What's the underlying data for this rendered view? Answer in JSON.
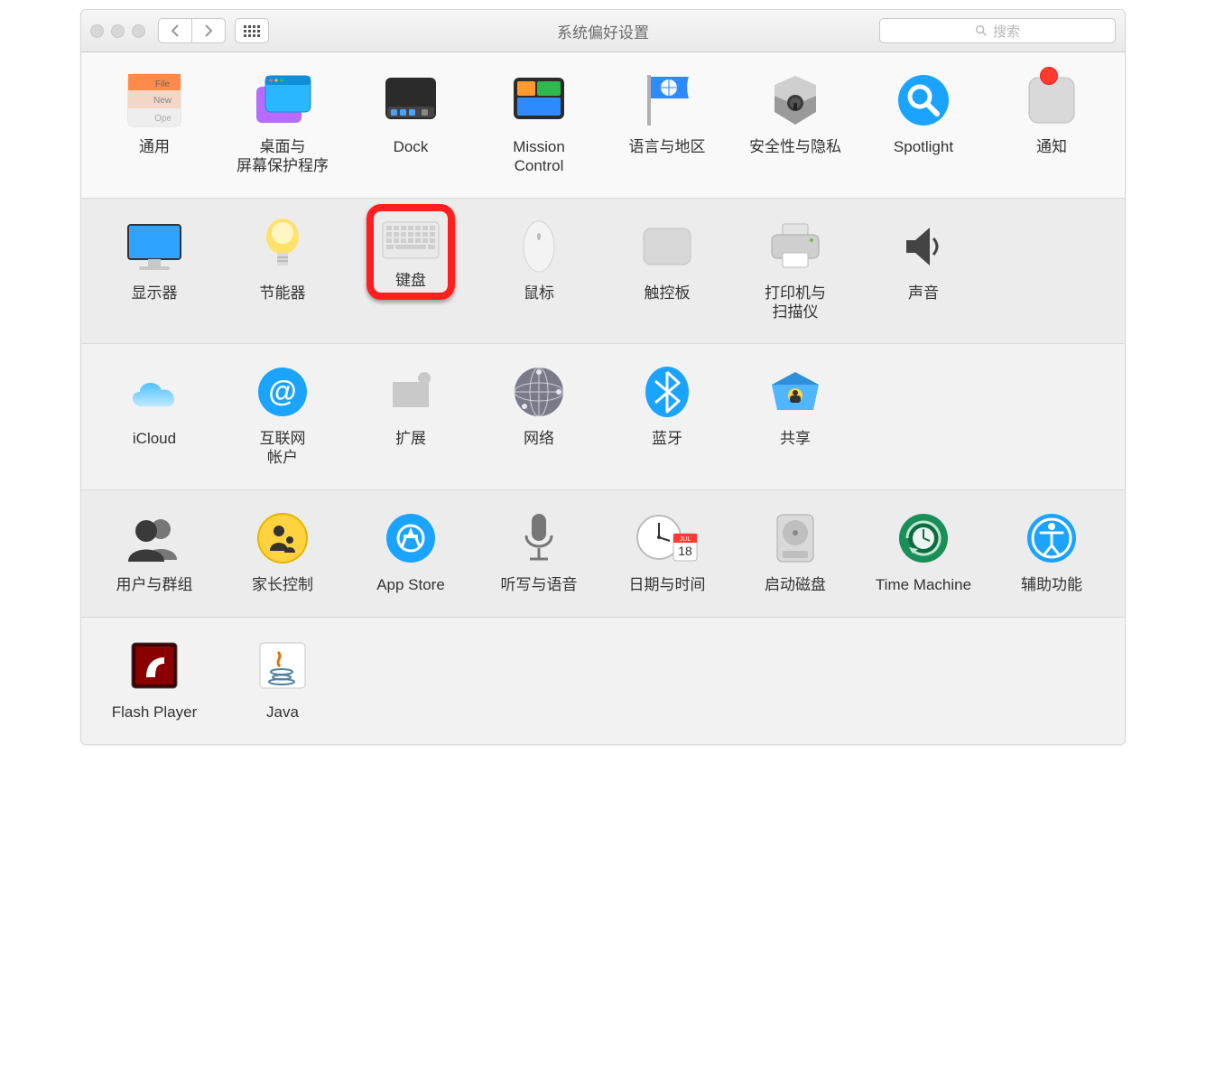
{
  "window": {
    "title": "系统偏好设置"
  },
  "search": {
    "placeholder": "搜索"
  },
  "rows": [
    [
      {
        "id": "general",
        "label": "通用"
      },
      {
        "id": "desktop",
        "label": "桌面与\n屏幕保护程序"
      },
      {
        "id": "dock",
        "label": "Dock"
      },
      {
        "id": "mission",
        "label": "Mission\nControl"
      },
      {
        "id": "language",
        "label": "语言与地区"
      },
      {
        "id": "security",
        "label": "安全性与隐私"
      },
      {
        "id": "spotlight",
        "label": "Spotlight"
      },
      {
        "id": "notifications",
        "label": "通知",
        "badge": true
      }
    ],
    [
      {
        "id": "displays",
        "label": "显示器"
      },
      {
        "id": "energy",
        "label": "节能器"
      },
      {
        "id": "keyboard",
        "label": "键盘",
        "highlight": true
      },
      {
        "id": "mouse",
        "label": "鼠标"
      },
      {
        "id": "trackpad",
        "label": "触控板"
      },
      {
        "id": "printers",
        "label": "打印机与\n扫描仪"
      },
      {
        "id": "sound",
        "label": "声音"
      }
    ],
    [
      {
        "id": "icloud",
        "label": "iCloud"
      },
      {
        "id": "internet",
        "label": "互联网\n帐户"
      },
      {
        "id": "extensions",
        "label": "扩展"
      },
      {
        "id": "network",
        "label": "网络"
      },
      {
        "id": "bluetooth",
        "label": "蓝牙"
      },
      {
        "id": "sharing",
        "label": "共享"
      }
    ],
    [
      {
        "id": "users",
        "label": "用户与群组"
      },
      {
        "id": "parental",
        "label": "家长控制"
      },
      {
        "id": "appstore",
        "label": "App Store"
      },
      {
        "id": "dictation",
        "label": "听写与语音"
      },
      {
        "id": "datetime",
        "label": "日期与时间"
      },
      {
        "id": "startup",
        "label": "启动磁盘"
      },
      {
        "id": "timemachine",
        "label": "Time Machine"
      },
      {
        "id": "accessibility",
        "label": "辅助功能"
      }
    ],
    [
      {
        "id": "flash",
        "label": "Flash Player"
      },
      {
        "id": "java",
        "label": "Java"
      }
    ]
  ],
  "calendar": {
    "month": "JUL",
    "day": "18"
  }
}
